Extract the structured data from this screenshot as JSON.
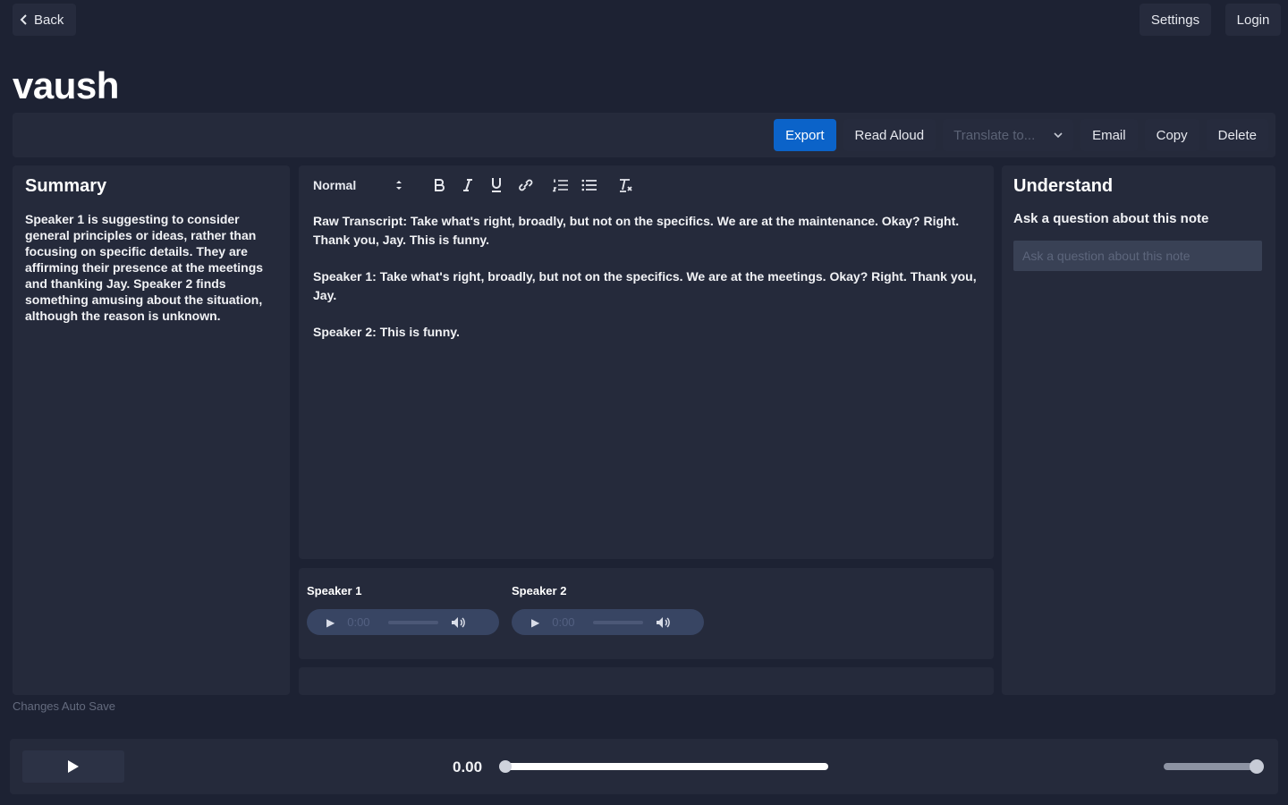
{
  "header": {
    "back_label": "Back",
    "settings_label": "Settings",
    "login_label": "Login"
  },
  "page": {
    "title": "vaush",
    "autosave_note": "Changes Auto Save"
  },
  "toolbar": {
    "export_label": "Export",
    "read_aloud_label": "Read Aloud",
    "translate_placeholder": "Translate to...",
    "email_label": "Email",
    "copy_label": "Copy",
    "delete_label": "Delete"
  },
  "summary": {
    "heading": "Summary",
    "text": "Speaker 1 is suggesting to consider general principles or ideas, rather than focusing on specific details. They are affirming their presence at the meetings and thanking Jay. Speaker 2 finds something amusing about the situation, although the reason is unknown."
  },
  "editor": {
    "format_value": "Normal",
    "paragraphs": [
      "Raw Transcript: Take what's right, broadly, but not on the specifics. We are at the maintenance. Okay? Right. Thank you, Jay. This is funny.",
      "Speaker 1:  Take what's right, broadly, but not on the specifics. We are at the meetings. Okay? Right. Thank you, Jay.",
      "Speaker 2:  This is funny."
    ],
    "tools": [
      "bold-icon",
      "italic-icon",
      "underline-icon",
      "link-icon",
      "ordered-list-icon",
      "bullet-list-icon",
      "clear-format-icon"
    ]
  },
  "audio": {
    "speakers": [
      {
        "label": "Speaker 1",
        "time": "0:00"
      },
      {
        "label": "Speaker 2",
        "time": "0:00"
      }
    ]
  },
  "understand": {
    "heading": "Understand",
    "subheading": "Ask a question about this note",
    "input_placeholder": "Ask a question about this note"
  },
  "player": {
    "time": "0.00",
    "progress": 0,
    "volume": 1
  },
  "colors": {
    "background": "#1d2233",
    "panel": "#252a3b",
    "accent": "#0b63c9"
  }
}
